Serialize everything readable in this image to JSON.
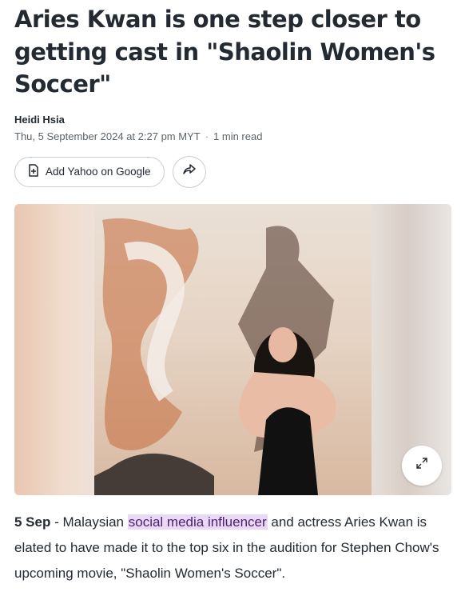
{
  "article": {
    "headline": "Aries Kwan is one step closer to getting cast in \"Shaolin Women's Soccer\"",
    "author": "Heidi Hsia",
    "timestamp": "Thu, 5 September 2024 at 2:27 pm MYT",
    "separator": "·",
    "read_time": "1 min read",
    "actions": {
      "add_google_label": "Add Yahoo on Google"
    },
    "body": {
      "dateline": "5 Sep",
      "dash": " - Malaysian ",
      "link_text": "social media influencer",
      "rest": " and actress Aries Kwan is elated to have made it to the top six in the audition for Stephen Chow's upcoming movie, \"Shaolin Women's Soccer\"."
    }
  },
  "icons": {
    "add_google": "document-plus-icon",
    "share": "share-arrow-icon",
    "expand": "expand-arrows-icon"
  },
  "colors": {
    "link_highlight_bg": "#ead9f5",
    "link_text": "#4a1f6e",
    "text": "#232a31"
  }
}
